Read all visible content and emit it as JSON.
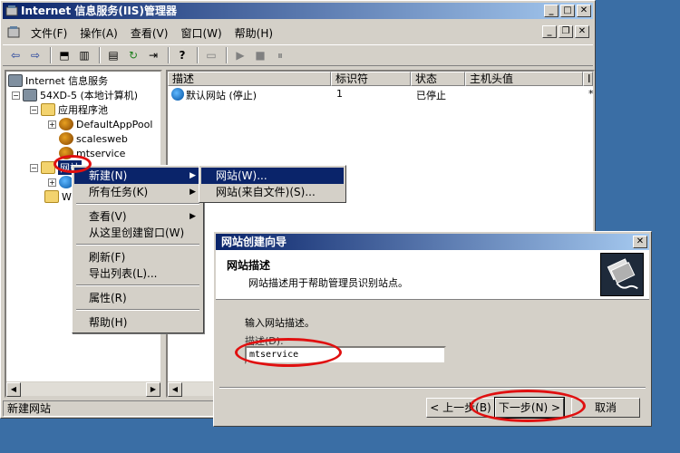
{
  "window": {
    "title": "Internet 信息服务(IIS)管理器",
    "cap_min": "_",
    "cap_max": "□",
    "cap_close": "✕"
  },
  "menu": {
    "items": [
      "文件(F)",
      "操作(A)",
      "查看(V)",
      "窗口(W)",
      "帮助(H)"
    ],
    "mdi_min": "_",
    "mdi_restore": "❐",
    "mdi_close": "✕"
  },
  "toolbar": {
    "back": "⇦",
    "forward": "⇨",
    "up": "⬒",
    "show_tree": "▥",
    "properties": "▤",
    "refresh": "↻",
    "export": "⇥",
    "help": "?",
    "connect": "▭",
    "play": "▶",
    "stop": "■",
    "pause": "⏸"
  },
  "tree": {
    "root": "Internet 信息服务",
    "computer": "54XD-5 (本地计算机)",
    "app_pools": "应用程序池",
    "pool1": "DefaultAppPool",
    "pool2": "scalesweb",
    "pool3": "mtservice",
    "websites": "网站",
    "web_ext_partial": "We"
  },
  "list": {
    "columns": [
      "描述",
      "标识符",
      "状态",
      "主机头值",
      "I"
    ],
    "row": {
      "desc": "默认网站 (停止)",
      "id": "1",
      "status": "已停止",
      "host": "",
      "ip": "*"
    }
  },
  "status": {
    "text": "新建网站"
  },
  "context_menu": {
    "new": "新建(N)",
    "all_tasks": "所有任务(K)",
    "view": "查看(V)",
    "new_window": "从这里创建窗口(W)",
    "refresh": "刷新(F)",
    "export": "导出列表(L)...",
    "properties": "属性(R)",
    "help": "帮助(H)"
  },
  "submenu": {
    "website": "网站(W)...",
    "website_from_file": "网站(来自文件)(S)..."
  },
  "dialog": {
    "title": "网站创建向导",
    "close": "✕",
    "heading": "网站描述",
    "subheading": "网站描述用于帮助管理员识别站点。",
    "instruction": "输入网站描述。",
    "field_label": "描述(D):",
    "field_value": "mtservice",
    "back_label": "< 上一步(B)",
    "next_label": "下一步(N) >",
    "cancel_label": "取消"
  },
  "colors": {
    "desktop": "#3a6ea5",
    "title_active": "#0a246a",
    "highlight": "#0a246a",
    "face": "#d4d0c8",
    "annotation": "#e01010"
  }
}
